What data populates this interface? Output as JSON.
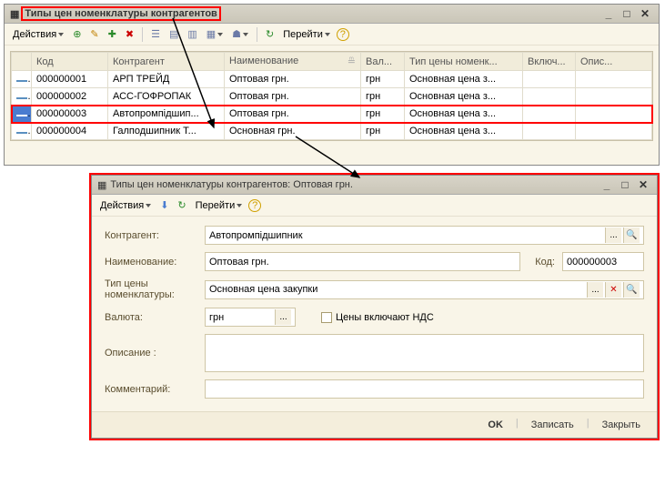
{
  "main": {
    "title": "Типы цен номенклатуры контрагентов",
    "actions_label": "Действия",
    "goto_label": "Перейти",
    "columns": {
      "code": "Код",
      "counterparty": "Контрагент",
      "name": "Наименование",
      "currency": "Вал...",
      "price_type": "Тип цены номенк...",
      "included": "Включ...",
      "description": "Опис..."
    },
    "rows": [
      {
        "code": "000000001",
        "counterparty": "АРП ТРЕЙД",
        "name": "Оптовая грн.",
        "currency": "грн",
        "price_type": "Основная цена з..."
      },
      {
        "code": "000000002",
        "counterparty": "АСС-ГОФРОПАК",
        "name": "Оптовая грн.",
        "currency": "грн",
        "price_type": "Основная цена з..."
      },
      {
        "code": "000000003",
        "counterparty": "Автопромпідшип...",
        "name": "Оптовая грн.",
        "currency": "грн",
        "price_type": "Основная цена з...",
        "selected": true
      },
      {
        "code": "000000004",
        "counterparty": "Галподшипник  Т...",
        "name": "Основная грн.",
        "currency": "грн",
        "price_type": "Основная цена з..."
      }
    ]
  },
  "child": {
    "title": "Типы цен номенклатуры контрагентов: Оптовая грн.",
    "actions_label": "Действия",
    "goto_label": "Перейти",
    "labels": {
      "counterparty": "Контрагент:",
      "name": "Наименование:",
      "code": "Код:",
      "price_type_line1": "Тип цены",
      "price_type_line2": "номенклатуры:",
      "currency": "Валюта:",
      "vat": "Цены включают НДС",
      "description": "Описание :",
      "comment": "Комментарий:"
    },
    "values": {
      "counterparty": "Автопромпідшипник",
      "name": "Оптовая грн.",
      "code": "000000003",
      "price_type": "Основная цена закупки",
      "currency": "грн",
      "description": "",
      "comment": ""
    },
    "footer": {
      "ok": "OK",
      "save": "Записать",
      "close": "Закрыть"
    }
  }
}
